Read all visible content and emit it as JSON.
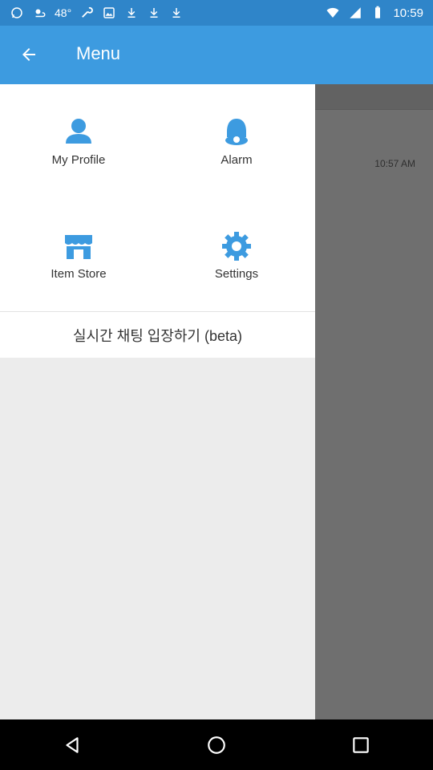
{
  "status_bar": {
    "left_icons": [
      "whatsapp-icon",
      "weather-icon",
      "wrench-icon",
      "gallery-icon",
      "download-icon",
      "download-icon",
      "download-icon"
    ],
    "temperature": "48°",
    "time": "10:59"
  },
  "app_bar": {
    "title": "Menu"
  },
  "drawer": {
    "items": [
      {
        "label": "My Profile",
        "icon": "person-icon"
      },
      {
        "label": "Alarm",
        "icon": "bell-icon"
      },
      {
        "label": "Item Store",
        "icon": "store-icon"
      },
      {
        "label": "Settings",
        "icon": "gear-icon"
      }
    ],
    "chat_label": "실시간 채팅 입장하기 (beta)"
  },
  "background": {
    "time": "10:57 AM"
  },
  "colors": {
    "status_bar": "#2f85c9",
    "app_bar": "#3d9be0",
    "icon_accent": "#3d9be0"
  }
}
